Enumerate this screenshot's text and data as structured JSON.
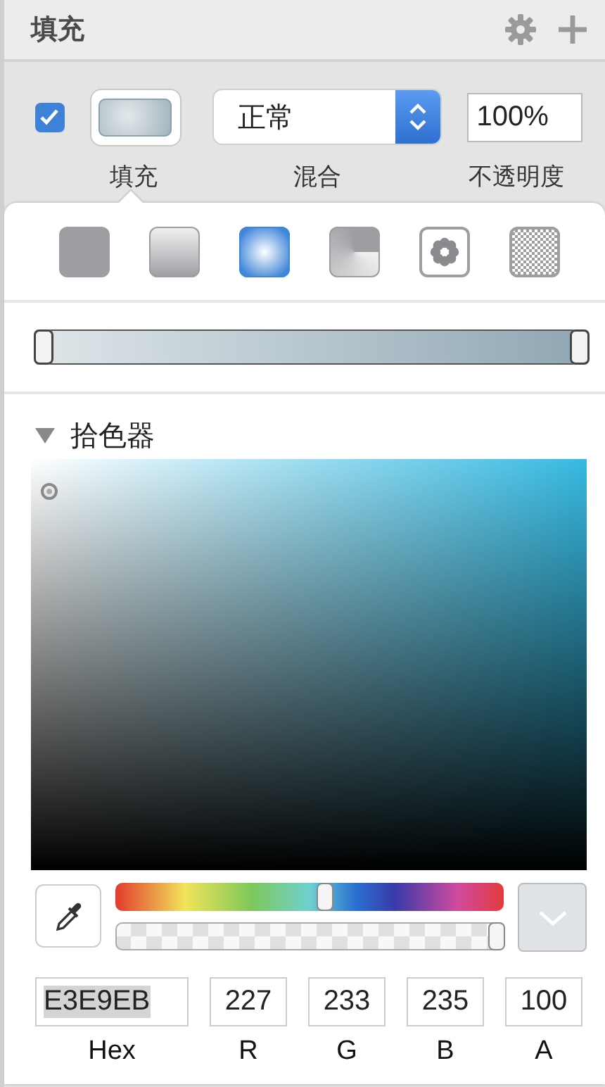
{
  "panel": {
    "title": "填充"
  },
  "fill": {
    "enabled": true,
    "blend_mode": "正常",
    "opacity": "100%",
    "labels": [
      "填充",
      "混合",
      "不透明度"
    ]
  },
  "fill_types": [
    {
      "kind": "solid",
      "selected": false
    },
    {
      "kind": "linear",
      "selected": false
    },
    {
      "kind": "radial",
      "selected": true
    },
    {
      "kind": "angular",
      "selected": false
    },
    {
      "kind": "pattern",
      "selected": false
    },
    {
      "kind": "noise",
      "selected": false
    }
  ],
  "gradient": {
    "stops": [
      {
        "level": 0
      },
      {
        "level": 1
      }
    ]
  },
  "color_picker": {
    "title": "拾色器",
    "expanded": true,
    "hue": {
      "level": 0.54
    },
    "alpha": {
      "level": 1
    },
    "fields": [
      {
        "label": "Hex",
        "value": "E3E9EB",
        "highlighted": true
      },
      {
        "label": "R",
        "value": "227",
        "highlighted": false
      },
      {
        "label": "G",
        "value": "233",
        "highlighted": false
      },
      {
        "label": "B",
        "value": "235",
        "highlighted": false
      },
      {
        "label": "A",
        "value": "100",
        "highlighted": false
      }
    ]
  }
}
